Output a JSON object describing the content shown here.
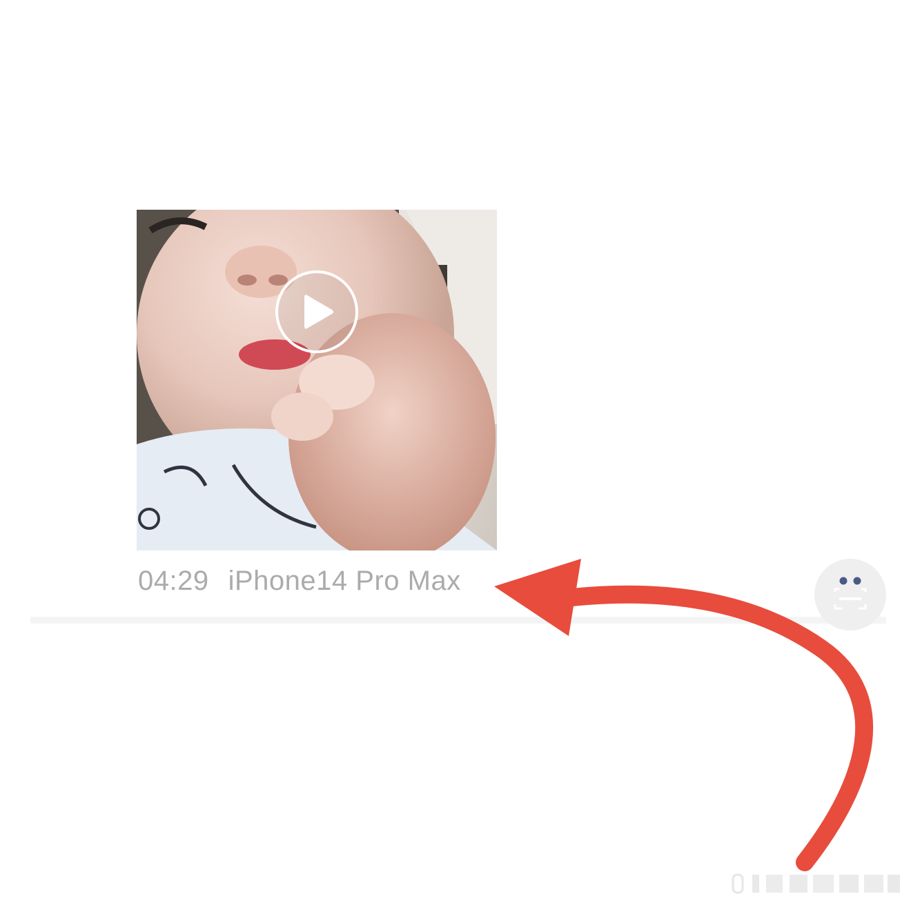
{
  "post": {
    "video": {
      "icon": "play-icon"
    },
    "time": "04:29",
    "device": "iPhone14 Pro Max"
  },
  "floating_button": {
    "icon": "robot-face-icon"
  },
  "annotation": {
    "color": "#e84c3d"
  },
  "colors": {
    "meta_text": "#ababab",
    "divider": "#f4f4f4"
  }
}
